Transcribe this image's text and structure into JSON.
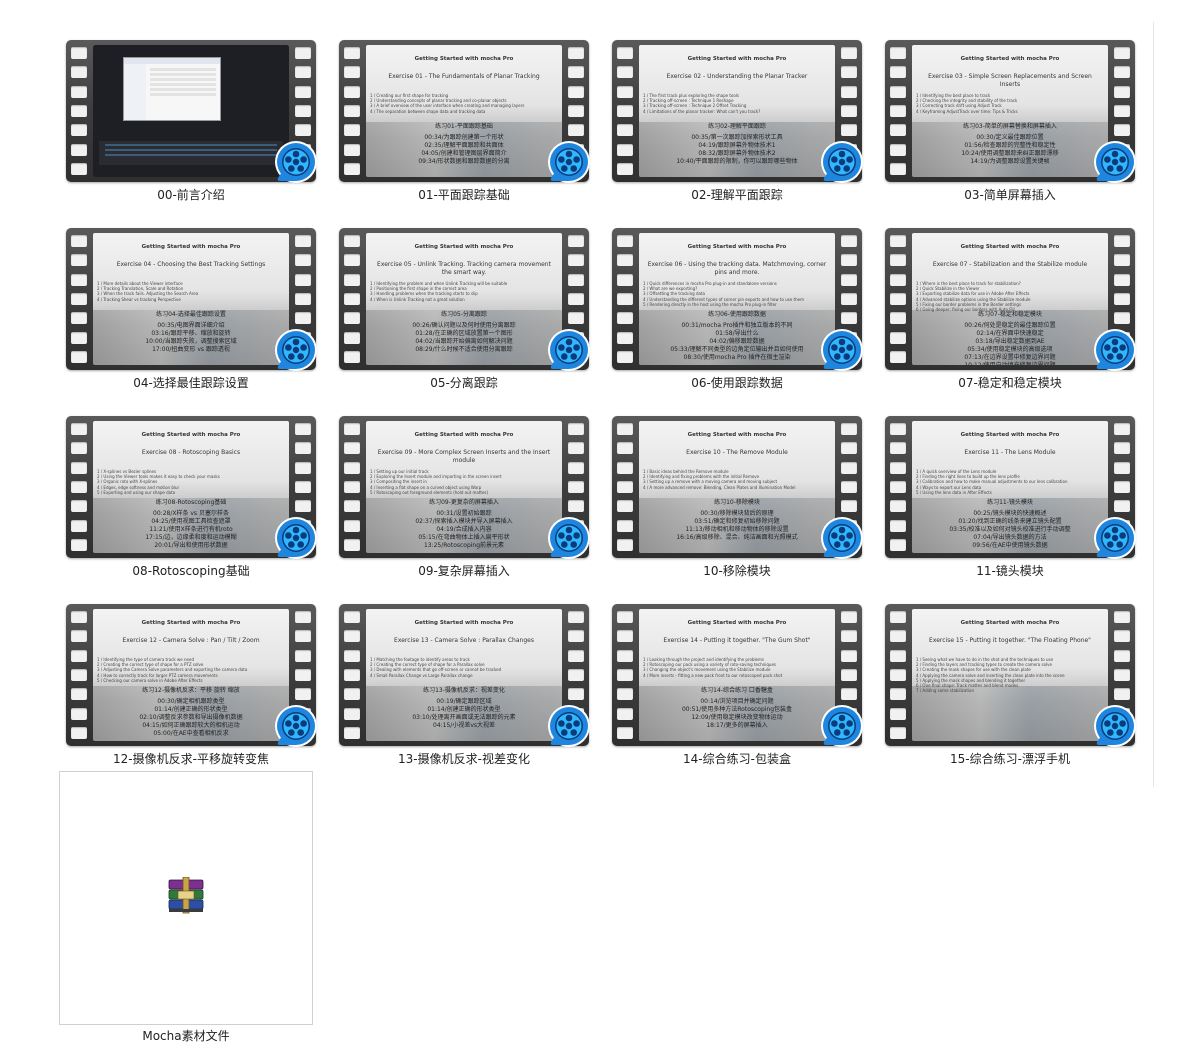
{
  "items": [
    {
      "label": "00-前言介绍",
      "kind": "desktop"
    },
    {
      "label": "01-平面跟踪基础",
      "head": "Getting Started with mocha Pro",
      "ex": "Exercise 01 - The Fundamentals of Planar Tracking",
      "bullets": [
        "1 / Creating our first shape for tracking",
        "2 / Understanding concepts of planar tracking and co-planar objects",
        "3 / A brief overview of the user interface when creating and managing layers",
        "4 / The separation between shape data and tracking data"
      ],
      "cn": "练习01-平面跟踪基础",
      "ts": [
        "00:34/为跟踪创建第一个形状",
        "02:35/理解平面跟踪和共面体",
        "04:05/创建和管理图层界面简介",
        "09:34/形状数据和跟踪数据的分离"
      ]
    },
    {
      "label": "02-理解平面跟踪",
      "head": "Getting Started with mocha Pro",
      "ex": "Exercise 02 - Understanding the Planar Tracker",
      "bullets": [
        "1 / The first track plus exploring the shape tools",
        "2 / Tracking off-screen : Technique 1 Reshape",
        "3 / Tracking off-screen : Technique 2 Offset Tracking",
        "4 / Limitations of the planar tracker: What can't you track?"
      ],
      "cn": "练习02-理解平面跟踪",
      "ts": [
        "00:35/第一次跟踪加探索形状工具",
        "04:19/跟踪屏幕外物体技术1",
        "08:32/跟踪屏幕外物体技术2",
        "10:40/平面跟踪的限制，你可以跟踪哪些物体"
      ]
    },
    {
      "label": "03-简单屏幕插入",
      "head": "Getting Started with mocha Pro",
      "ex": "Exercise 03 - Simple Screen Replacements and Screen Inserts",
      "bullets": [
        "1 / Identifying the best place to track",
        "2 / Checking the integrity and stability of the track",
        "3 / Correcting track drift using Adjust Track",
        "4 / Keyframing AdjustTrack over time: Tips & Tricks"
      ],
      "cn": "练习03-简单的屏幕替换和屏幕插入",
      "ts": [
        "00:30/定义最佳跟踪位置",
        "01:56/检查跟踪的完整性和稳定性",
        "10:24/使用调整跟踪来纠正跟踪漂移",
        "14:19/为调整跟踪设置关键帧"
      ]
    },
    {
      "label": "04-选择最佳跟踪设置",
      "head": "Getting Started with mocha Pro",
      "ex": "Exercise 04 - Choosing the Best Tracking Settings",
      "bullets": [
        "1 / More details about the Viewer interface",
        "2 / Tracking Translation, Scale and Rotation",
        "3 / When the track fails. Adjusting the Search Area",
        "4 / Tracking Shear vs tracking Perspective"
      ],
      "cn": "练习04-选择最佳跟踪设置",
      "ts": [
        "00:35/电图界面详细介绍",
        "03:16/跟踪平移、缩放和旋转",
        "10:00/当跟踪失败，调整搜索区域",
        "17:00/扭曲变形 vs 跟踪透视"
      ]
    },
    {
      "label": "05-分离跟踪",
      "head": "Getting Started with mocha Pro",
      "ex": "Exercise 05 - Unlink Tracking. Tracking camera movement the smart way.",
      "bullets": [
        "1 / Identifying the problem and when Unlink Tracking will be suitable",
        "2 / Positioning the first shape in the correct area",
        "3 / Handling problems when the tracking starts to slip",
        "4 / When is Unlink Tracking not a great solution"
      ],
      "cn": "练习05-分离跟踪",
      "ts": [
        "00:26/确认问题以及何时使用分离跟踪",
        "01:28/在正确的区域放置第一个图形",
        "04:02/当跟踪开始偏离如何解决问题",
        "08:29/什么时候不适合使用分离跟踪"
      ]
    },
    {
      "label": "06-使用跟踪数据",
      "head": "Getting Started with mocha Pro",
      "ex": "Exercise 06 - Using the tracking data. Matchmoving, corner pins and more.",
      "bullets": [
        "1 / Quick differences in mocha Pro plug-in and standalone versions",
        "2 / What are we exporting?",
        "3 / Offsetting the tracking data",
        "4 / Understanding the different types of corner pin exports and how to use them",
        "5 / Rendering directly in the host using the mocha Pro plug-in filter"
      ],
      "cn": "练习06-使用跟踪数据",
      "ts": [
        "00:31/mocha Pro插件和独立版本的不同",
        "01:58/导出什么",
        "04:02/偏移跟踪数据",
        "05:33/理解不同类型的边角定位输出并且如何使用",
        "08:30/使用mocha Pro 插件在宿主渲染"
      ]
    },
    {
      "label": "07-稳定和稳定模块",
      "head": "Getting Started with mocha Pro",
      "ex": "Exercise 07 - Stabilization and the Stabilize module",
      "bullets": [
        "1 / Where is the best place to track for stabilization?",
        "2 / Quick Stabilize in the Viewer",
        "3 / Exporting stabilize data for use in Adobe After Effects",
        "4 / Advanced stabilize options using the Stabilize module",
        "5 / Fixing our border problems in the Border settings",
        "6 / Going deeper: fixing our borders with Auto Fill"
      ],
      "cn": "练习07-稳定和稳定模块",
      "ts": [
        "00:26/何处是稳定的最佳跟踪位置",
        "02:14/在界面中快速稳定",
        "03:18/导出稳定数据到AE",
        "05:34/使用稳定模块的高级选项",
        "07:13/在边界设置中修复边界问题",
        "10:12/使用自动填充修复边界问题"
      ]
    },
    {
      "label": "08-Rotoscoping基础",
      "head": "Getting Started with mocha Pro",
      "ex": "Exercise 08 - Rotoscoping Basics",
      "bullets": [
        "1 / X-splines vs Bezier splines",
        "2 / Using the Viewer tools makes it easy to check your masks",
        "3 / Organic roto with X-splines",
        "4 / Edges, edge softness and motion blur",
        "5 / Exporting and using our shape data"
      ],
      "cn": "练习08-Rotoscoping基础",
      "ts": [
        "00:28/X样条 vs 贝塞尔样条",
        "04:25/使用视图工具检查遮罩",
        "11:21/使用X样条进行有机roto",
        "17:15/边，边缘柔和度和运动模糊",
        "20:01/导出和使用形状数据"
      ]
    },
    {
      "label": "09-复杂屏幕插入",
      "head": "Getting Started with mocha Pro",
      "ex": "Exercise 09 - More Complex Screen Inserts and the Insert module",
      "bullets": [
        "1 / Setting up our initial track",
        "2 / Exploring the Insert module and importing in the screen insert",
        "3 / Compositing the insert in",
        "4 / Inserting a flat shape on a curved object using Warp",
        "5 / Rotoscoping out foreground elements (hold out mattes)"
      ],
      "cn": "练习09-更复杂的屏幕插入",
      "ts": [
        "00:31/设置初始跟踪",
        "02:37/探索插入模块并导入屏幕插入",
        "04:19/合成插入内容",
        "05:15/在弯曲物体上插入扁平形状",
        "13:25/Rotoscoping前景元素"
      ]
    },
    {
      "label": "10-移除模块",
      "head": "Getting Started with mocha Pro",
      "ex": "Exercise 10 - The Remove Module",
      "bullets": [
        "1 / Basic ideas behind the Remove module",
        "2 / Identifying and fixing problems with the initial Remove",
        "3 / Setting up a remove with a moving camera and moving subject",
        "4 / A more advanced remove: Blending, Clean Plates and Illumination Model"
      ],
      "cn": "练习10-移除模块",
      "ts": [
        "00:30/移除模块背后的原理",
        "03:51/确定和修复初始移除问题",
        "11:13/移动相机和移动物体的移除设置",
        "16:16/高级移除、混合、纯洁画面和光照模式"
      ]
    },
    {
      "label": "11-镜头模块",
      "head": "Getting Started with mocha Pro",
      "ex": "Exercise 11 - The Lens Module",
      "bullets": [
        "1 / A quick overview of the Lens module",
        "2 / Finding the right lines to build up the lens profile",
        "3 / Calibration and how to make manual adjustments to our lens calibration",
        "4 / Ways to export our Lens data",
        "5 / Using the lens data in After Effects"
      ],
      "cn": "练习11-镜头模块",
      "ts": [
        "00:25/镜头模块的快速概述",
        "01:20/找到正确的线条来建立镜头配置",
        "03:35/校准以及如何对镜头校准进行手动调整",
        "07:04/导出镜头数据的方法",
        "09:56/在AE中使用镜头数据"
      ]
    },
    {
      "label": "12-摄像机反求-平移旋转变焦",
      "head": "Getting Started with mocha Pro",
      "ex": "Exercise 12 - Camera Solve : Pan / Tilt / Zoom",
      "bullets": [
        "1 / Identifying the type of camera track we need",
        "2 / Creating the correct type of shape for a PTZ solve",
        "3 / Adjusting the Camera Solve parameters and exporting the camera data",
        "4 / How to correctly track for larger PTZ camera movements",
        "5 / Checking our camera solve in Adobe After Effects"
      ],
      "cn": "练习12-摄像机反求：平移 旋转 缩放",
      "ts": [
        "00:30/确定相机跟踪类型",
        "01:14/创建正确的形状类型",
        "02:10/调整反求参数和导出摄像机数据",
        "04:15/如何正确跟踪较大的相机运动",
        "05:00/在AE中查看相机反求"
      ]
    },
    {
      "label": "13-摄像机反求-视差变化",
      "head": "Getting Started with mocha Pro",
      "ex": "Exercise 13 - Camera Solve : Parallax Changes",
      "bullets": [
        "1 / Matching the footage to identify areas to track",
        "2 / Creating the correct type of shape for a Parallax solve",
        "3 / Dealing with elements that go off-screen or cannot be tracked",
        "4 / Small Parallax Change vs Large Parallax change"
      ],
      "cn": "练习13-摄像机反求：视差变化",
      "ts": [
        "00:19/确定跟踪区域",
        "01:14/创建正确的形状类型",
        "03:10/处理离开画面或无法跟踪的元素",
        "04:15/小视差vs大视差"
      ]
    },
    {
      "label": "14-综合练习-包装盒",
      "head": "Getting Started with mocha Pro",
      "ex": "Exercise 14 - Putting it together. \"The Gum Shot\"",
      "bullets": [
        "1 / Looking through the project and identifying the problems",
        "2 / Rotoscoping our pack using a variety of roto-saving techniques",
        "3 / Changing the object's movement using the Stabilize module",
        "4 / More inserts - fitting a new pack front to our rotoscoped pack shot"
      ],
      "cn": "练习14-综合练习 口香糖盒",
      "ts": [
        "00:14/浏览项目并确定问题",
        "00:51/使用多种方法Rotoscoping包装盒",
        "12:09/使用稳定模块改变物体运动",
        "18:17/更多的屏幕插入"
      ]
    },
    {
      "label": "15-综合练习-漂浮手机",
      "head": "Getting Started with mocha Pro",
      "ex": "Exercise 15 - Putting it together. \"The Floating Phone\"",
      "bullets": [
        "1 / Seeing what we have to do in the shot and the techniques to use",
        "2 / Finding the layers and tracking types to create the camera solve",
        "3 / Creating the mask shapes for use with the clean plate",
        "4 / Applying the camera solve and inserting the clean plate into the scene",
        "5 / Applying the mask shapes and blending it together",
        "6 / One final shape: Track mattes and blend modes",
        "7 / Adding some stabilization"
      ],
      "cn": "",
      "ts": []
    }
  ],
  "folder": {
    "label": "Mocha素材文件",
    "icon": "winrar-archive-icon"
  }
}
